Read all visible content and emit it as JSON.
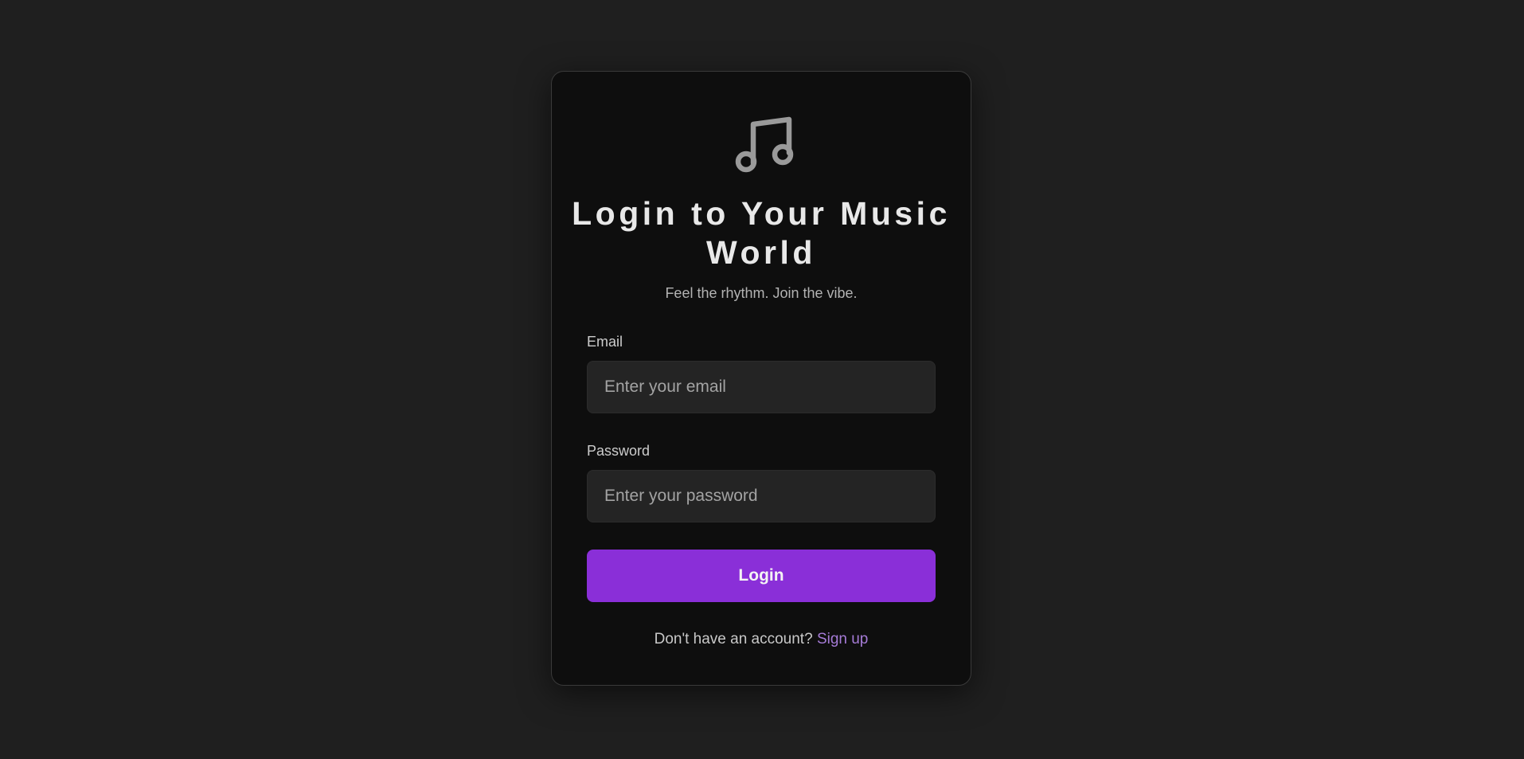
{
  "brand": {
    "icon": "music-note-icon",
    "icon_color": "#9a9a9a"
  },
  "header": {
    "title": "Login to Your Music World",
    "subtitle": "Feel the rhythm. Join the vibe."
  },
  "form": {
    "email_label": "Email",
    "email_placeholder": "Enter your email",
    "email_value": "",
    "password_label": "Password",
    "password_placeholder": "Enter your password",
    "password_value": "",
    "login_label": "Login"
  },
  "footer": {
    "prompt": "Don't have an account?",
    "signup_label": "Sign up"
  },
  "colors": {
    "page_background": "#1f1f1f",
    "card_background": "#0e0e0e",
    "accent": "#8a2fd8",
    "link": "#a57bd6"
  }
}
